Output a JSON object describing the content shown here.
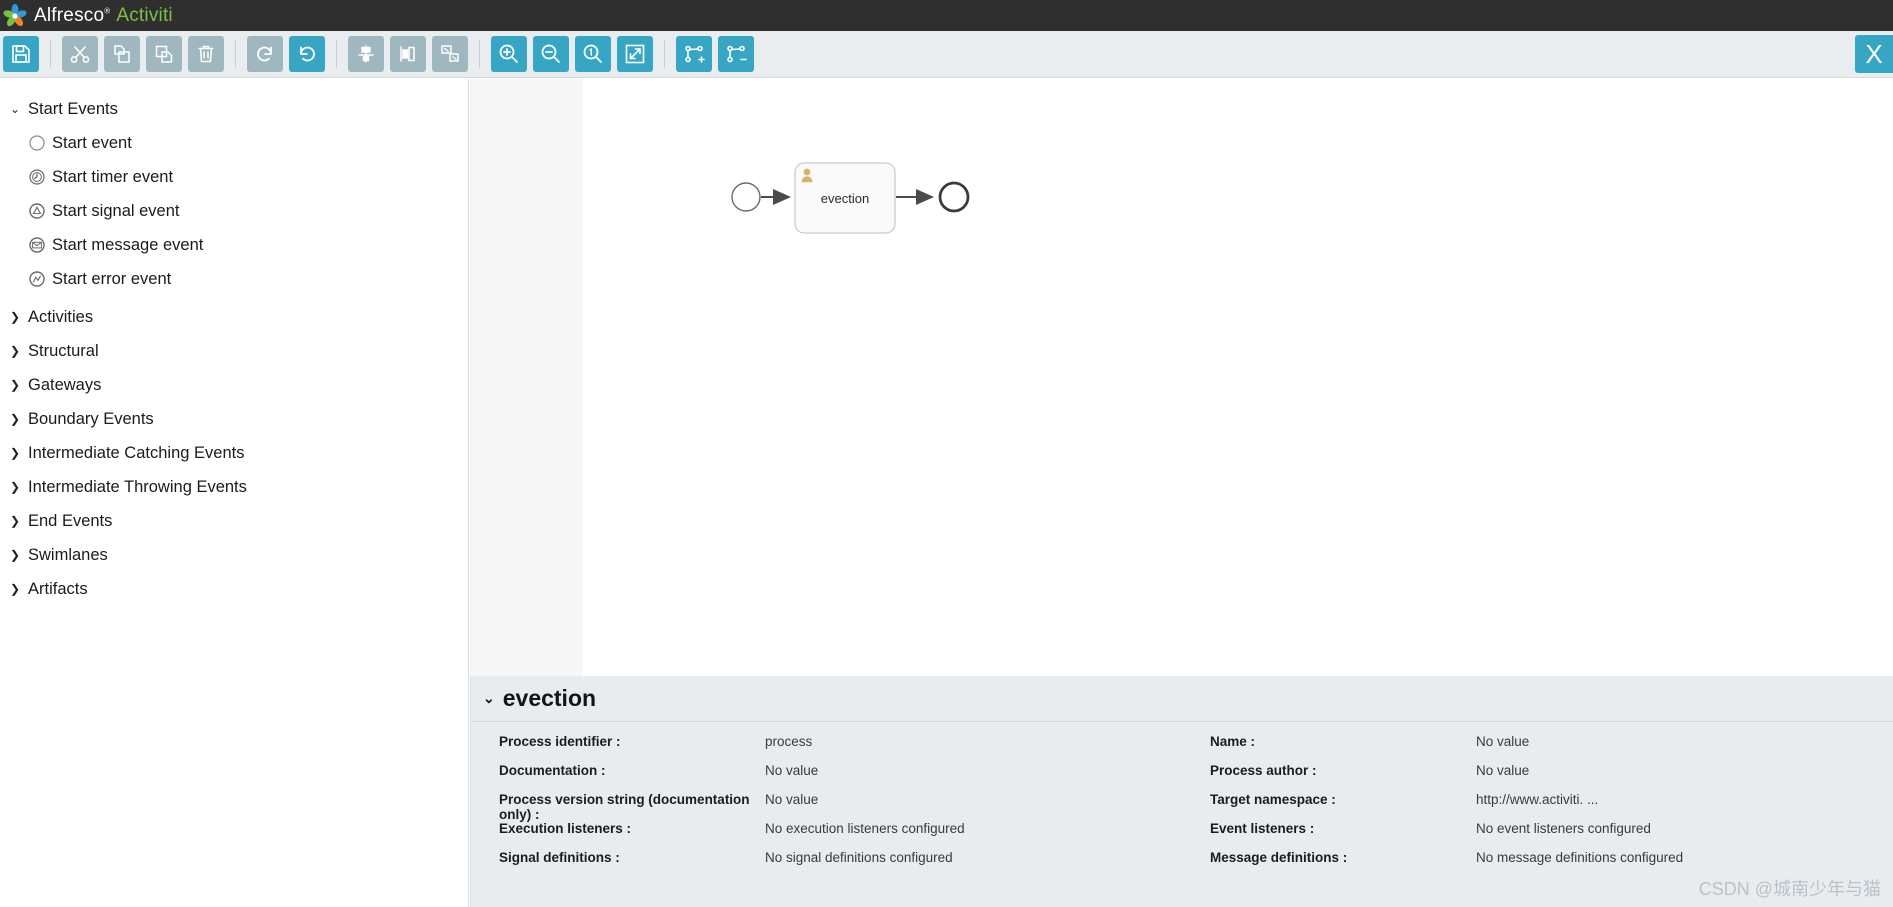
{
  "brand": {
    "name_1": "Alfresco",
    "registered_mark": "®",
    "name_2": "Activiti",
    "logo_icon": "alfresco-pinwheel-logo",
    "bar_color": "#2f2f2f",
    "accent_color": "#7ac143"
  },
  "toolbar": {
    "active_color": "#36a6c4",
    "inactive_color": "#9fb7bf",
    "buttons": [
      {
        "name": "save-button",
        "icon": "floppy-disk-icon",
        "state": "active"
      },
      {
        "name": "cut-button",
        "icon": "scissors-icon",
        "state": "inactive"
      },
      {
        "name": "copy-button",
        "icon": "copy-icon",
        "state": "inactive"
      },
      {
        "name": "paste-button",
        "icon": "paste-icon",
        "state": "inactive"
      },
      {
        "name": "delete-button",
        "icon": "trash-icon",
        "state": "inactive"
      },
      {
        "name": "redo-button",
        "icon": "redo-arrow-icon",
        "state": "inactive"
      },
      {
        "name": "undo-button",
        "icon": "undo-arrow-icon",
        "state": "active"
      },
      {
        "name": "align-vertical-button",
        "icon": "align-vertical-icon",
        "state": "inactive"
      },
      {
        "name": "align-horizontal-button",
        "icon": "align-horizontal-icon",
        "state": "inactive"
      },
      {
        "name": "same-size-button",
        "icon": "resize-same-size-icon",
        "state": "inactive"
      },
      {
        "name": "zoom-in-button",
        "icon": "magnifier-plus-icon",
        "state": "active"
      },
      {
        "name": "zoom-out-button",
        "icon": "magnifier-minus-icon",
        "state": "active"
      },
      {
        "name": "zoom-actual-button",
        "icon": "magnifier-one-icon",
        "state": "active"
      },
      {
        "name": "zoom-fit-button",
        "icon": "zoom-fit-icon",
        "state": "active"
      },
      {
        "name": "add-bendpoint-button",
        "icon": "bendpoint-plus-icon",
        "state": "active"
      },
      {
        "name": "remove-bendpoint-button",
        "icon": "bendpoint-minus-icon",
        "state": "active"
      }
    ],
    "close_label": "X"
  },
  "palette": {
    "groups": [
      {
        "label": "Start Events",
        "expanded": true,
        "caret": "⌄",
        "items": [
          {
            "label": "Start event",
            "icon": "start-event-circle-icon"
          },
          {
            "label": "Start timer event",
            "icon": "start-timer-event-icon"
          },
          {
            "label": "Start signal event",
            "icon": "start-signal-event-icon"
          },
          {
            "label": "Start message event",
            "icon": "start-message-event-icon"
          },
          {
            "label": "Start error event",
            "icon": "start-error-event-icon"
          }
        ]
      },
      {
        "label": "Activities",
        "expanded": false,
        "caret": "❯",
        "items": []
      },
      {
        "label": "Structural",
        "expanded": false,
        "caret": "❯",
        "items": []
      },
      {
        "label": "Gateways",
        "expanded": false,
        "caret": "❯",
        "items": []
      },
      {
        "label": "Boundary Events",
        "expanded": false,
        "caret": "❯",
        "items": []
      },
      {
        "label": "Intermediate Catching Events",
        "expanded": false,
        "caret": "❯",
        "items": []
      },
      {
        "label": "Intermediate Throwing Events",
        "expanded": false,
        "caret": "❯",
        "items": []
      },
      {
        "label": "End Events",
        "expanded": false,
        "caret": "❯",
        "items": []
      },
      {
        "label": "Swimlanes",
        "expanded": false,
        "caret": "❯",
        "items": []
      },
      {
        "label": "Artifacts",
        "expanded": false,
        "caret": "❯",
        "items": []
      }
    ]
  },
  "diagram": {
    "start_event": {
      "name": "start-event-shape"
    },
    "task": {
      "label": "evection",
      "type": "user-task",
      "icon": "user-task-person-icon"
    },
    "end_event": {
      "name": "end-event-shape"
    },
    "flows": 2
  },
  "properties": {
    "title": "evection",
    "caret": "⌄",
    "left_column": [
      {
        "label": "Process identifier :",
        "value": "process"
      },
      {
        "label": "Documentation :",
        "value": "No value"
      },
      {
        "label": "Process version string (documentation only) :",
        "value": "No value"
      },
      {
        "label": "Execution listeners :",
        "value": "No execution listeners configured"
      },
      {
        "label": "Signal definitions :",
        "value": "No signal definitions configured"
      }
    ],
    "right_column": [
      {
        "label": "Name :",
        "value": "No value"
      },
      {
        "label": "Process author :",
        "value": "No value"
      },
      {
        "label": "Target namespace :",
        "value": "http://www.activiti. ..."
      },
      {
        "label": "Event listeners :",
        "value": "No event listeners configured"
      },
      {
        "label": "Message definitions :",
        "value": "No message definitions configured"
      }
    ]
  },
  "watermark": {
    "text": "CSDN @城南少年与猫"
  }
}
